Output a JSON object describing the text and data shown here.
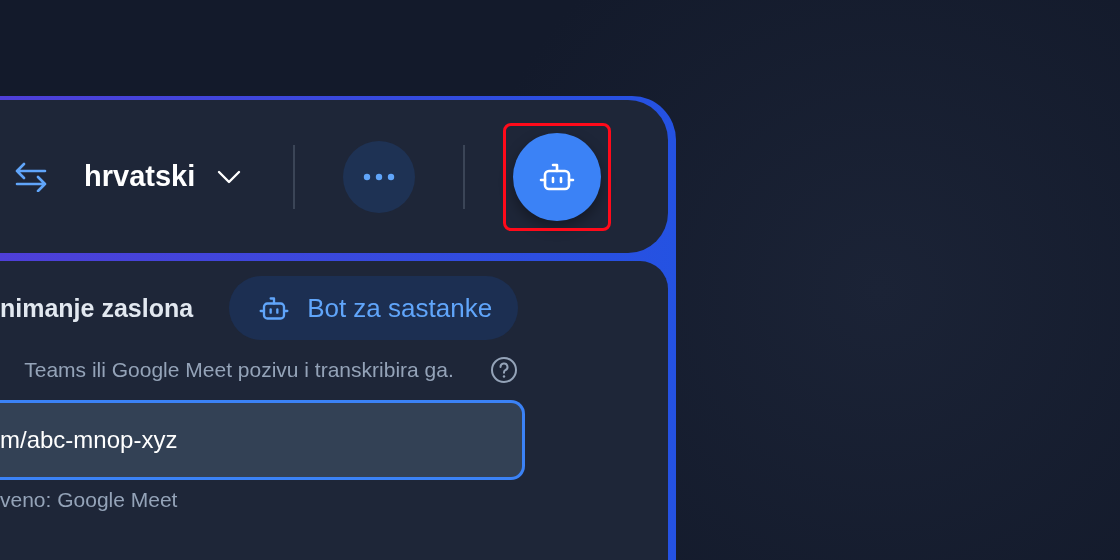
{
  "top_bar": {
    "language": "hrvatski",
    "bot_button": {
      "highlighted": true
    }
  },
  "panel": {
    "title": "nimanje zaslona",
    "mode_button": "Bot za sastanke",
    "description": "Teams ili Google Meet pozivu i transkribira ga.",
    "link_field": {
      "value": "m/abc-mnop-xyz",
      "focused": true
    },
    "hint": "veno: Google Meet"
  }
}
